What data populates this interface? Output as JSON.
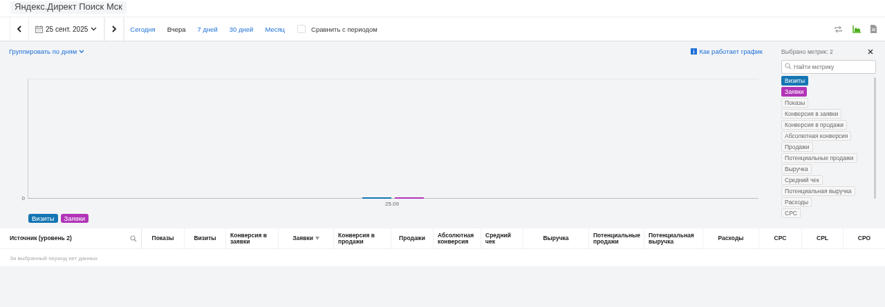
{
  "title": "Яндекс.Директ Поиск Мск",
  "toolbar": {
    "date": "25 сент. 2025",
    "periods": [
      {
        "label": "Сегодня",
        "selected": false
      },
      {
        "label": "Вчера",
        "selected": true
      },
      {
        "label": "7 дней",
        "selected": false
      },
      {
        "label": "30 дней",
        "selected": false
      },
      {
        "label": "Месяц",
        "selected": false
      }
    ],
    "compare": {
      "label": "Сравнить с периодом",
      "checked": false
    }
  },
  "group_by": "Группировать по дням",
  "help_link": "Как работает график",
  "chart": {
    "y_tick": "0",
    "x_label": "25.09"
  },
  "legend": [
    {
      "label": "Визиты",
      "color": "#1576b3"
    },
    {
      "label": "Заявки",
      "color": "#b134b8"
    }
  ],
  "metrics_panel": {
    "title": "Выбрано метрик: 2",
    "search_placeholder": "Найти метрику",
    "metrics": [
      {
        "label": "Визиты",
        "selected": true,
        "color": "#1576b3"
      },
      {
        "label": "Заявки",
        "selected": true,
        "color": "#b134b8"
      },
      {
        "label": "Показы",
        "selected": false
      },
      {
        "label": "Конверсия в заявки",
        "selected": false
      },
      {
        "label": "Конверсия в продажи",
        "selected": false
      },
      {
        "label": "Абсолютная конверсия",
        "selected": false
      },
      {
        "label": "Продажи",
        "selected": false
      },
      {
        "label": "Потенциальные продажи",
        "selected": false
      },
      {
        "label": "Выручка",
        "selected": false
      },
      {
        "label": "Средний чек",
        "selected": false
      },
      {
        "label": "Потенциальная выручка",
        "selected": false
      },
      {
        "label": "Расходы",
        "selected": false
      },
      {
        "label": "CPC",
        "selected": false
      }
    ]
  },
  "table": {
    "columns": [
      {
        "label": "Источник (уровень 2)",
        "kind": "source"
      },
      {
        "label": "Показы",
        "kind": "center"
      },
      {
        "label": "Визиты",
        "kind": "center"
      },
      {
        "label": "Конверсия в заявки",
        "kind": "left"
      },
      {
        "label": "Заявки",
        "kind": "sorted"
      },
      {
        "label": "Конверсия в продажи",
        "kind": "left"
      },
      {
        "label": "Продажи",
        "kind": "center"
      },
      {
        "label": "Абсолютная конверсия",
        "kind": "left"
      },
      {
        "label": "Средний чек",
        "kind": "left"
      },
      {
        "label": "Выручка",
        "kind": "center"
      },
      {
        "label": "Потенциальные продажи",
        "kind": "left"
      },
      {
        "label": "Потенциальная выручка",
        "kind": "left"
      },
      {
        "label": "Расходы",
        "kind": "center"
      },
      {
        "label": "CPC",
        "kind": "center"
      },
      {
        "label": "CPL",
        "kind": "center"
      },
      {
        "label": "CPO",
        "kind": "center"
      }
    ],
    "empty_message": "За выбранный период нет данных"
  }
}
